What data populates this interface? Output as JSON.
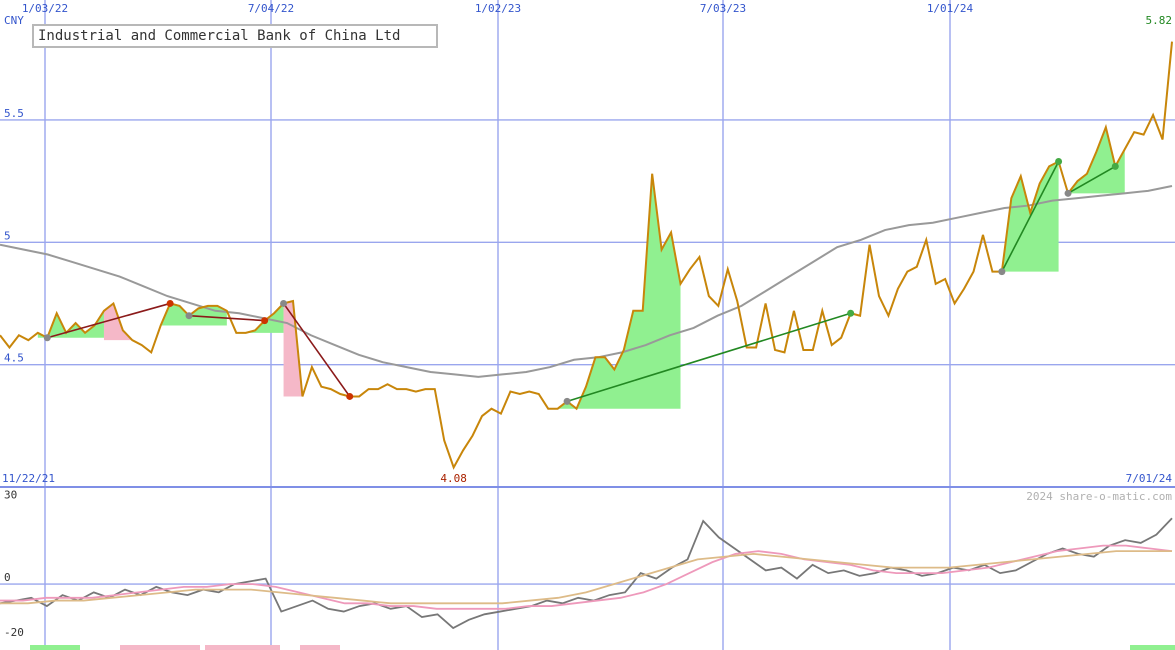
{
  "chart_data": {
    "type": "line",
    "title": "Industrial and Commercial Bank of China Ltd",
    "currency": "CNY",
    "price_panel": {
      "y_ticks": [
        {
          "value": 5.5,
          "label": "5.5"
        },
        {
          "value": 5.0,
          "label": "5"
        },
        {
          "value": 4.5,
          "label": "4.5"
        }
      ],
      "x_ticks": [
        "1/03/22",
        "7/04/22",
        "1/02/23",
        "7/03/23",
        "1/01/24"
      ],
      "start_date": "11/22/21",
      "end_date": "7/01/24",
      "min_label": "4.08",
      "last_label": "5.82",
      "ylim": [
        4.0,
        5.99
      ],
      "series": [
        {
          "name": "price",
          "color": "#c8860a",
          "values": [
            4.62,
            4.57,
            4.62,
            4.6,
            4.63,
            4.61,
            4.71,
            4.63,
            4.67,
            4.63,
            4.66,
            4.72,
            4.75,
            4.64,
            4.6,
            4.58,
            4.55,
            4.66,
            4.75,
            4.74,
            4.7,
            4.73,
            4.74,
            4.74,
            4.72,
            4.63,
            4.63,
            4.64,
            4.68,
            4.71,
            4.75,
            4.76,
            4.37,
            4.49,
            4.41,
            4.4,
            4.38,
            4.37,
            4.37,
            4.4,
            4.4,
            4.42,
            4.4,
            4.4,
            4.39,
            4.4,
            4.4,
            4.19,
            4.08,
            4.15,
            4.21,
            4.29,
            4.32,
            4.3,
            4.39,
            4.38,
            4.39,
            4.38,
            4.32,
            4.32,
            4.35,
            4.32,
            4.41,
            4.53,
            4.53,
            4.48,
            4.56,
            4.72,
            4.72,
            5.28,
            4.97,
            5.04,
            4.83,
            4.89,
            4.94,
            4.78,
            4.74,
            4.89,
            4.76,
            4.57,
            4.57,
            4.75,
            4.56,
            4.55,
            4.72,
            4.56,
            4.56,
            4.72,
            4.58,
            4.61,
            4.71,
            4.7,
            4.99,
            4.78,
            4.7,
            4.81,
            4.88,
            4.9,
            5.01,
            4.83,
            4.85,
            4.75,
            4.81,
            4.88,
            5.03,
            4.88,
            4.88,
            5.18,
            5.27,
            5.12,
            5.24,
            5.31,
            5.33,
            5.2,
            5.25,
            5.28,
            5.37,
            5.47,
            5.31,
            5.38,
            5.45,
            5.44,
            5.52,
            5.42,
            5.82
          ]
        },
        {
          "name": "moving average",
          "color": "#999999",
          "values": [
            4.99,
            4.97,
            4.95,
            4.92,
            4.89,
            4.86,
            4.82,
            4.78,
            4.75,
            4.72,
            4.71,
            4.69,
            4.67,
            4.62,
            4.58,
            4.54,
            4.51,
            4.49,
            4.47,
            4.46,
            4.45,
            4.46,
            4.47,
            4.49,
            4.52,
            4.53,
            4.55,
            4.58,
            4.62,
            4.65,
            4.7,
            4.74,
            4.8,
            4.86,
            4.92,
            4.98,
            5.01,
            5.05,
            5.07,
            5.08,
            5.1,
            5.12,
            5.14,
            5.15,
            5.17,
            5.18,
            5.19,
            5.2,
            5.21,
            5.23
          ]
        }
      ],
      "markers": [
        {
          "x": "1/03/22",
          "value": 4.63,
          "color": "#cc3300"
        },
        {
          "x": "7/04/22",
          "value": 4.36,
          "color": "#cc3300"
        },
        {
          "x": "1/02/23",
          "value": 4.29,
          "color": "#888888"
        },
        {
          "x": "7/03/23",
          "value": 4.75,
          "color": "#44aa44"
        },
        {
          "x": "1/01/24",
          "value": 5.18,
          "color": "#44aa44"
        },
        {
          "x": "7/01/24",
          "value": 5.42,
          "color": "#cc3300"
        }
      ]
    },
    "oscillator_panel": {
      "y_ticks": [
        {
          "value": 30,
          "label": "30"
        },
        {
          "value": 0,
          "label": "0"
        },
        {
          "value": -20,
          "label": "-20"
        }
      ],
      "ylim": [
        -24,
        35
      ],
      "series": [
        {
          "name": "momentum",
          "color": "#777777",
          "values": [
            -7,
            -6,
            -5,
            -8,
            -4,
            -6,
            -3,
            -5,
            -2,
            -4,
            -1,
            -3,
            -4,
            -2,
            -3,
            0,
            1,
            2,
            -10,
            -8,
            -6,
            -9,
            -10,
            -8,
            -7,
            -9,
            -8,
            -12,
            -11,
            -16,
            -13,
            -11,
            -10,
            -9,
            -8,
            -6,
            -7,
            -5,
            -6,
            -4,
            -3,
            4,
            2,
            6,
            9,
            23,
            17,
            13,
            9,
            5,
            6,
            2,
            7,
            4,
            5,
            3,
            4,
            6,
            5,
            3,
            4,
            6,
            5,
            7,
            4,
            5,
            8,
            11,
            13,
            11,
            10,
            14,
            16,
            15,
            18,
            24
          ]
        },
        {
          "name": "signal fast",
          "color": "#ee99bb",
          "values": [
            -6,
            -6,
            -5,
            -5,
            -5,
            -4,
            -3,
            -2,
            -1,
            -1,
            0,
            0,
            -1,
            -3,
            -5,
            -7,
            -7,
            -8,
            -8,
            -9,
            -9,
            -9,
            -9,
            -8,
            -8,
            -7,
            -6,
            -5,
            -3,
            0,
            4,
            8,
            11,
            12,
            11,
            9,
            8,
            7,
            5,
            4,
            4,
            4,
            5,
            6,
            8,
            10,
            12,
            13,
            14,
            14,
            13,
            12
          ]
        },
        {
          "name": "signal slow",
          "color": "#ddbb88",
          "values": [
            -7,
            -7,
            -6,
            -6,
            -5,
            -4,
            -3,
            -2,
            -2,
            -2,
            -3,
            -4,
            -5,
            -6,
            -7,
            -7,
            -7,
            -7,
            -7,
            -6,
            -5,
            -3,
            0,
            3,
            6,
            9,
            10,
            11,
            10,
            9,
            8,
            7,
            6,
            6,
            6,
            7,
            8,
            9,
            10,
            11,
            12,
            12,
            12
          ]
        }
      ]
    },
    "copyright": "2024 share-o-matic.com"
  }
}
